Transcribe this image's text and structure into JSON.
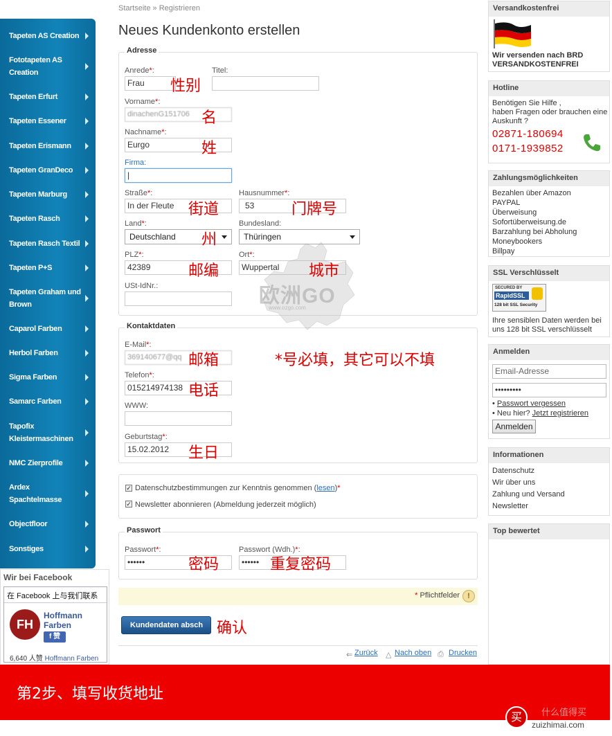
{
  "breadcrumb": {
    "home": "Startseite",
    "sep": " » ",
    "current": "Registrieren"
  },
  "page_title": "Neues Kundenkonto erstellen",
  "sidebar": {
    "items": [
      {
        "label": "Tapeten AS Creation"
      },
      {
        "label": "Fototapeten AS Creation"
      },
      {
        "label": "Tapeten Erfurt"
      },
      {
        "label": "Tapeten Essener"
      },
      {
        "label": "Tapeten Erismann"
      },
      {
        "label": "Tapeten GranDeco"
      },
      {
        "label": "Tapeten Marburg"
      },
      {
        "label": "Tapeten Rasch"
      },
      {
        "label": "Tapeten Rasch Textil"
      },
      {
        "label": "Tapeten P+S"
      },
      {
        "label": "Tapeten Graham und Brown"
      },
      {
        "label": "Caparol Farben"
      },
      {
        "label": "Herbol Farben"
      },
      {
        "label": "Sigma Farben"
      },
      {
        "label": "Samarc Farben"
      },
      {
        "label": "Tapofix Kleistermaschinen"
      },
      {
        "label": "NMC Zierprofile"
      },
      {
        "label": "Ardex Spachtelmasse"
      },
      {
        "label": "Objectfloor"
      },
      {
        "label": "Sonstiges"
      }
    ]
  },
  "facebook": {
    "heading": "Wir bei Facebook",
    "connect": "在 Facebook 上与我们联系",
    "logo": "FH",
    "page_name": "Hoffmann Farben",
    "like_button": "f 赞",
    "count_text": "6,640 人赞",
    "count_link": "Hoffmann Farben"
  },
  "form": {
    "required_mark": "*",
    "adresse": {
      "legend": "Adresse",
      "anrede_label": "Anrede",
      "anrede_value": "Frau",
      "titel_label": "Titel:",
      "vorname_label": "Vorname",
      "vorname_value": "dinachenG151706",
      "nachname_label": "Nachname",
      "nachname_value": "Eurgo",
      "firma_label": "Firma:",
      "strasse_label": "Straße",
      "strasse_value": "In der Fleute",
      "hausnummer_label": "Hausnummer",
      "hausnummer_value": "53",
      "land_label": "Land",
      "land_value": "Deutschland",
      "bundesland_label": "Bundesland:",
      "bundesland_value": "Thüringen",
      "plz_label": "PLZ",
      "plz_value": "42389",
      "ort_label": "Ort",
      "ort_value": "Wuppertal",
      "ustid_label": "USt-IdNr.:"
    },
    "kontakt": {
      "legend": "Kontaktdaten",
      "email_label": "E-Mail",
      "email_value": "369140677@qq",
      "telefon_label": "Telefon",
      "telefon_value": "015214974138",
      "www_label": "WWW:",
      "geburtstag_label": "Geburtstag",
      "geburtstag_value": "15.02.2012"
    },
    "checks": {
      "datenschutz_text": "Datenschutzbestimmungen zur Kenntnis genommen (",
      "datenschutz_link": "lesen",
      "datenschutz_end": ")",
      "newsletter_text": "Newsletter abonnieren (Abmeldung jederzeit möglich)"
    },
    "passwort": {
      "legend": "Passwort",
      "passwort_label": "Passwort",
      "passwort_value": "••••••",
      "passwort_wdh_label": "Passwort (Wdh.)",
      "passwort_wdh_value": "••••••"
    },
    "pflichtfelder": "Pflichtfelder",
    "submit_label": "Kundendaten absch"
  },
  "annotations": {
    "gender": "性别",
    "first_name": "名",
    "last_name": "姓",
    "street": "街道",
    "house_number": "门牌号",
    "state": "州",
    "zip": "邮编",
    "city": "城市",
    "email": "邮箱",
    "required_note": "*号必填，其它可以不填",
    "phone": "电话",
    "birthday": "生日",
    "password": "密码",
    "password_repeat": "重复密码",
    "confirm": "确认"
  },
  "footer_links": {
    "back": "Zurück",
    "up": "Nach oben",
    "print": "Drucken"
  },
  "watermark": {
    "text": "欧洲GO",
    "sub": "www.ozgo.com"
  },
  "right": {
    "versand": {
      "title": "Versandkostenfrei",
      "line1": "Wir versenden nach BRD",
      "line2": "VERSANDKOSTENFREI"
    },
    "hotline": {
      "title": "Hotline",
      "line1": "Benötigen Sie Hilfe ,",
      "line2": "haben Fragen oder brauchen eine",
      "line3": "Auskunft ?",
      "phone1": "02871-180694",
      "phone2": "0171-1939852"
    },
    "zahlung": {
      "title": "Zahlungsmöglichkeiten",
      "items": [
        "Bezahlen über Amazon",
        "PAYPAL",
        "Überweisung",
        "Sofortüberweisung.de",
        "Barzahlung bei Abholung",
        "Moneybookers",
        "Billpay"
      ]
    },
    "ssl": {
      "title": "SSL Verschlüsselt",
      "badge_line1": "SECURED BY",
      "badge_line2": "RapidSSL",
      "badge_line3": "128 bit SSL Security",
      "line1": "Ihre sensiblen Daten werden bei",
      "line2": "uns 128 bit SSL verschlüsselt"
    },
    "anmelden": {
      "title": "Anmelden",
      "email_placeholder": "Email-Adresse",
      "password_value": "•••••••••",
      "forgot": "Passwort vergessen",
      "new_prefix": "• Neu hier? ",
      "register": "Jetzt registrieren",
      "button": "Anmelden"
    },
    "informationen": {
      "title": "Informationen",
      "items": [
        "Datenschutz",
        "Wir über uns",
        "Zahlung und Versand",
        "Newsletter"
      ]
    },
    "top": {
      "title": "Top bewertet"
    }
  },
  "banner": {
    "text": "第2步、填写收货地址"
  },
  "smzdm": {
    "logo": "买",
    "name": "什么值得买",
    "url": "zuizhimai.com"
  },
  "colors": {
    "sidebar": "#0a6a9a",
    "annotation": "#e00000",
    "banner": "#ec0000",
    "link": "#2a6ebb"
  }
}
